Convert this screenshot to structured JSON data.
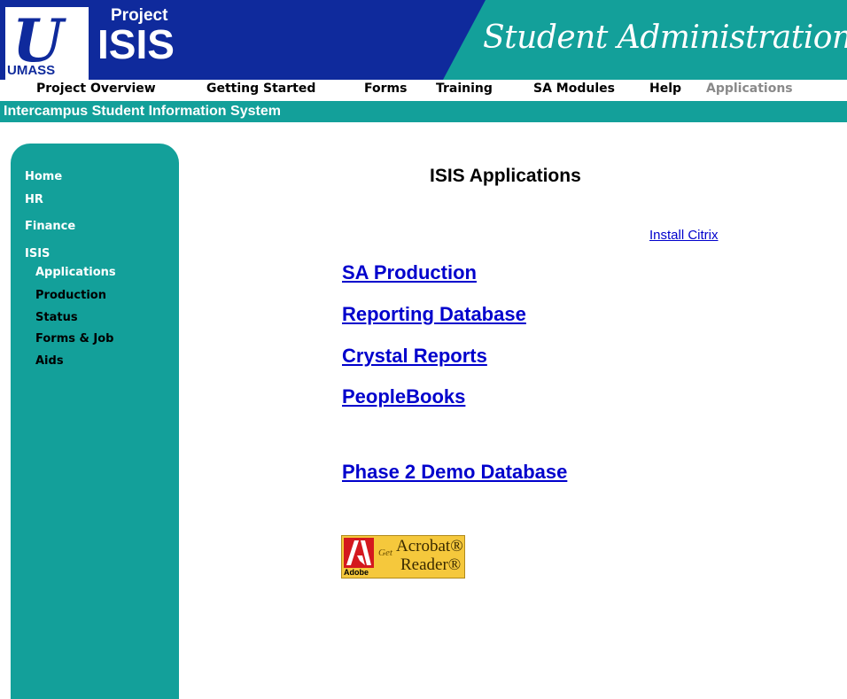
{
  "header": {
    "logo_letters": "U",
    "logo_text": "UMASS",
    "project_label": "Project",
    "project_name": "ISIS",
    "title": "Student Administration",
    "colors": {
      "navy": "#0f2a9c",
      "teal": "#13a09a"
    }
  },
  "topnav": {
    "items": [
      {
        "label": "Project Overview"
      },
      {
        "label": "Getting Started"
      },
      {
        "label": "Forms"
      },
      {
        "label": "Training"
      },
      {
        "label": "SA Modules"
      },
      {
        "label": "Help"
      },
      {
        "label": "Applications"
      }
    ]
  },
  "subbar": {
    "text": "Intercampus Student Information System"
  },
  "sidebar": {
    "items": [
      {
        "label": "Home"
      },
      {
        "label": "HR"
      },
      {
        "label": "Finance"
      },
      {
        "label": "ISIS"
      }
    ],
    "subitems": [
      {
        "label": "Applications"
      },
      {
        "label": "Production"
      },
      {
        "label": "Status"
      },
      {
        "label": "Forms & Job"
      },
      {
        "label": "Aids"
      }
    ]
  },
  "main": {
    "title": "ISIS Applications",
    "install_link": "Install Citrix",
    "links": [
      {
        "label": "SA Production"
      },
      {
        "label": "Reporting Database"
      },
      {
        "label": "Crystal Reports"
      },
      {
        "label": "PeopleBooks"
      },
      {
        "label": "Phase 2 Demo Database"
      }
    ]
  },
  "acrobat_badge": {
    "brand": "Adobe",
    "get": "Get",
    "line1": "Acrobat®",
    "line2": "Reader®",
    "icon": "adobe-logo-icon"
  }
}
